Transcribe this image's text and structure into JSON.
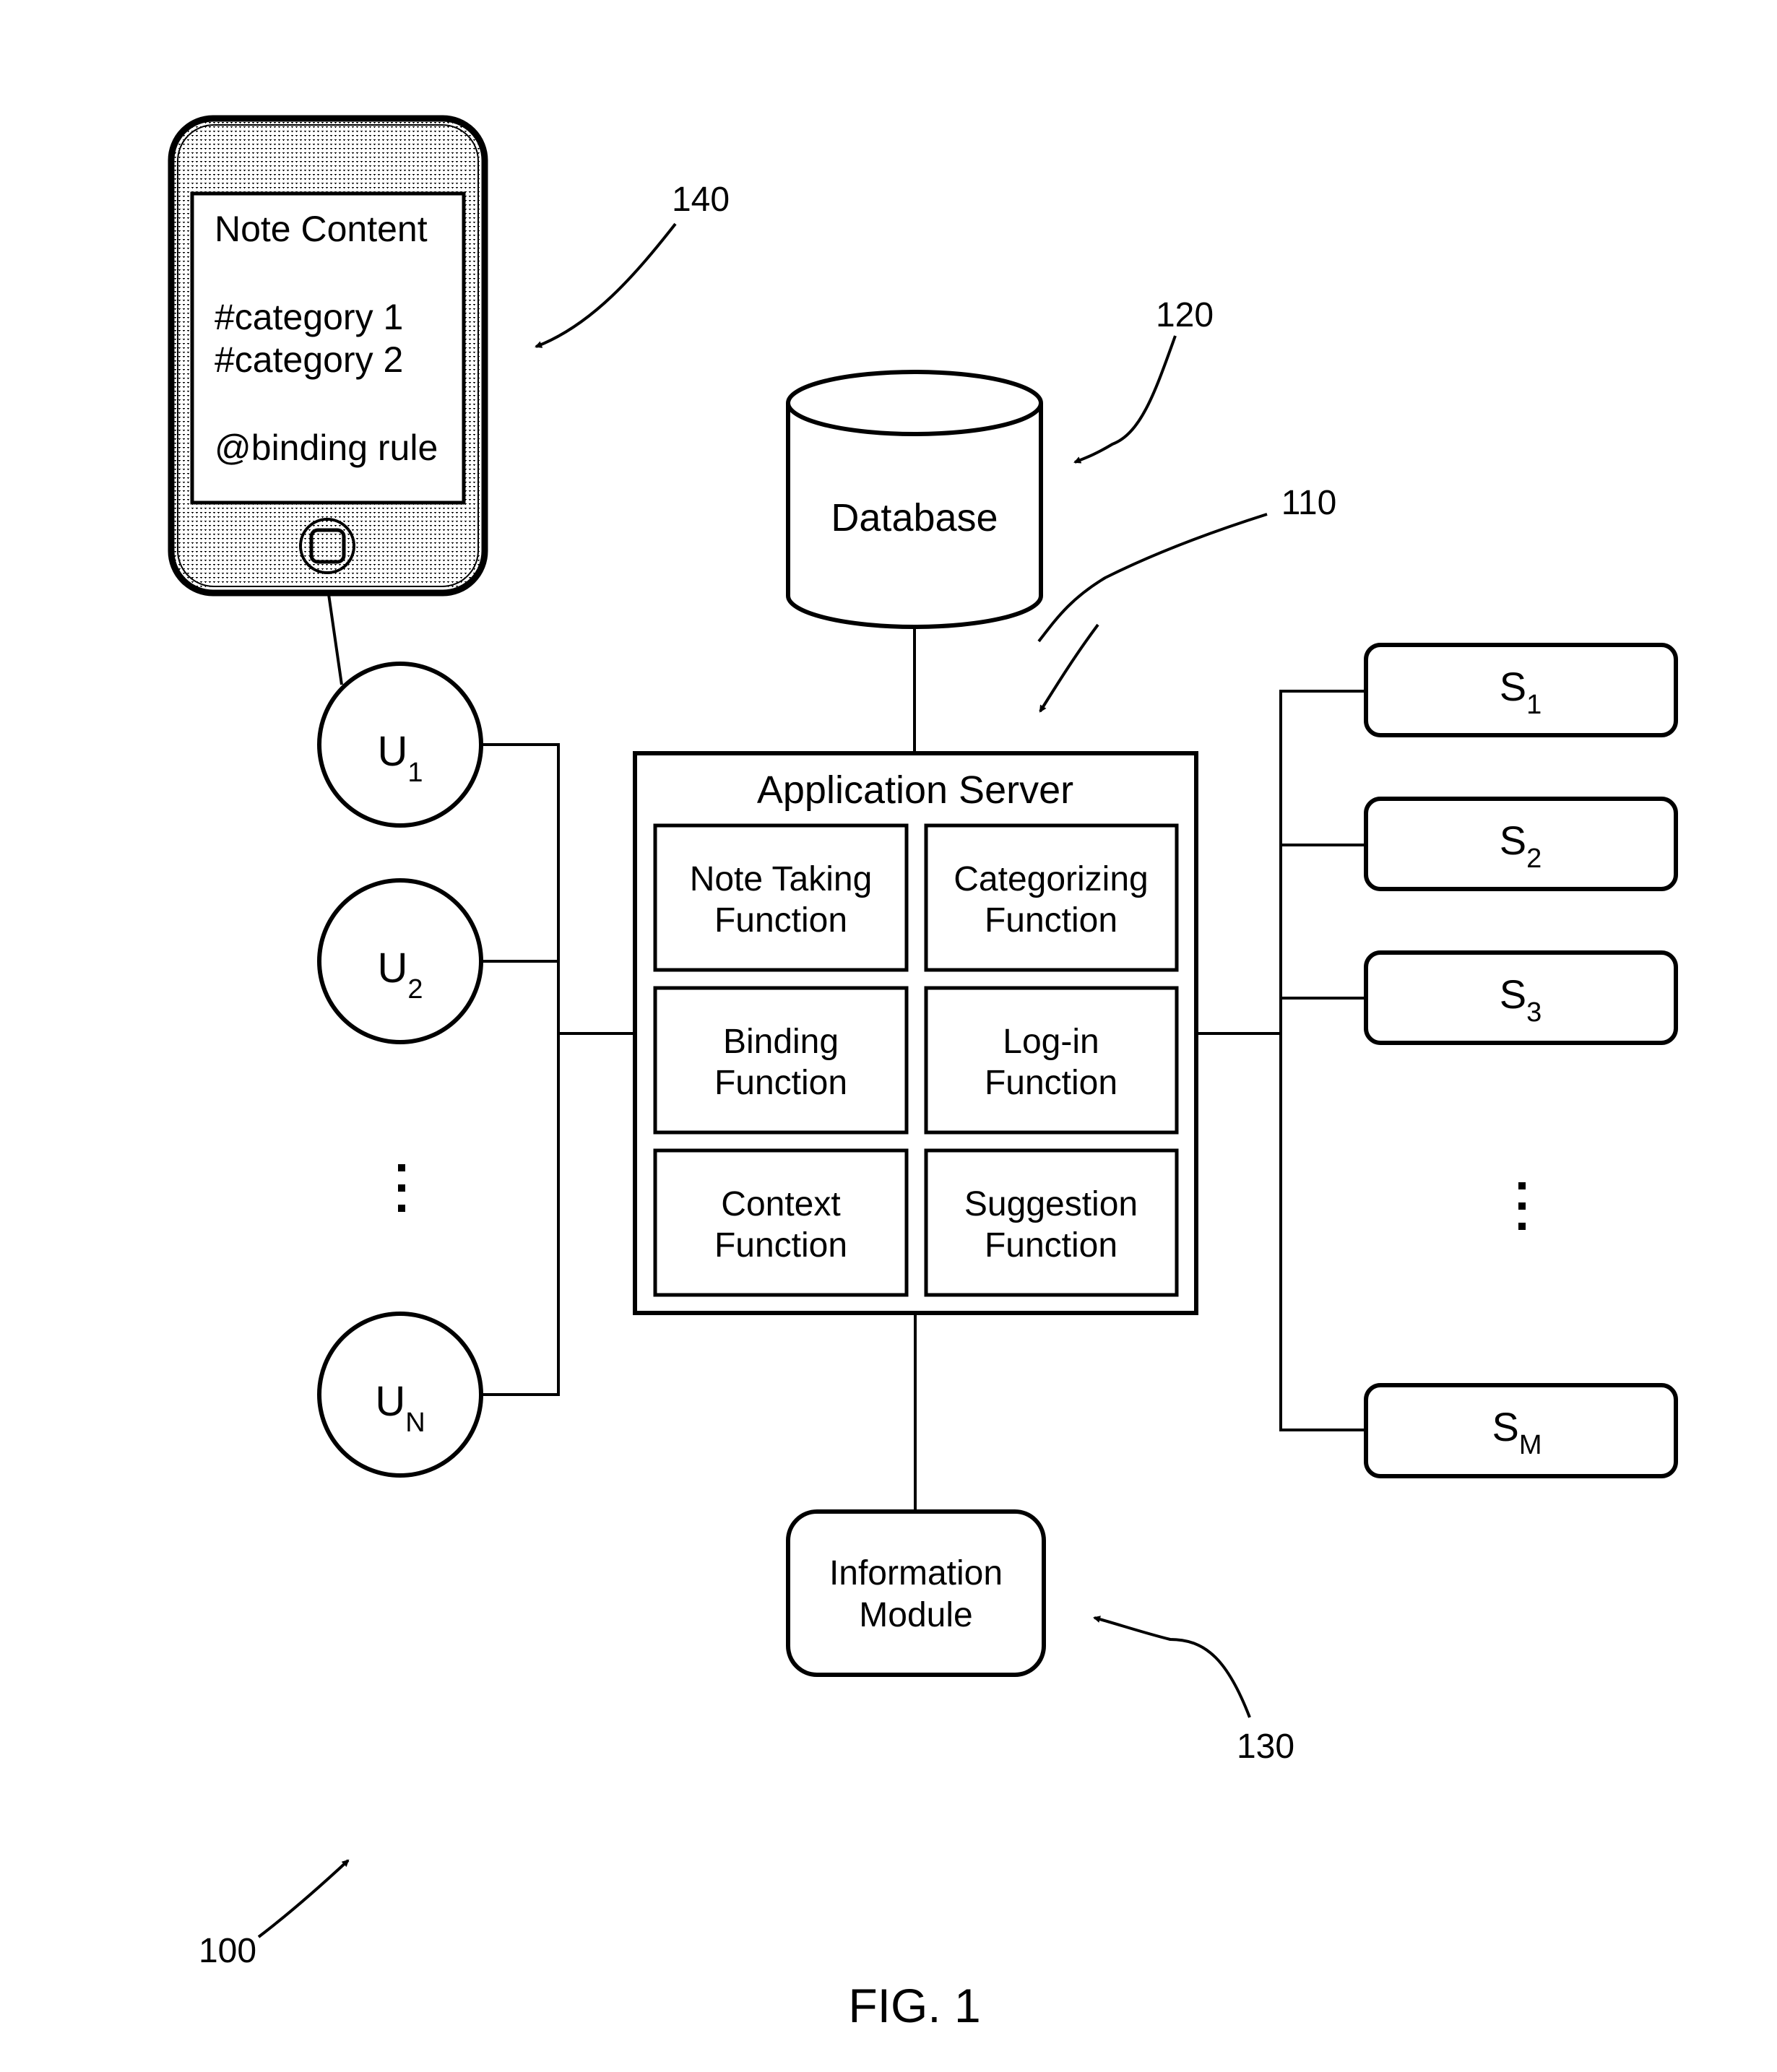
{
  "figure": {
    "caption": "FIG. 1",
    "reference_numerals": {
      "system": "100",
      "application_server": "110",
      "database": "120",
      "information_module": "130",
      "user_device": "140"
    }
  },
  "colors": {
    "stroke": "#000000",
    "background": "#ffffff",
    "device_fill_pattern": "dotted-gray"
  },
  "user_device": {
    "screen_lines": [
      "Note Content",
      "#category 1",
      "#category 2",
      "@binding rule"
    ],
    "icon": "smartphone-icon",
    "home_button_icon": "home-button-icon"
  },
  "users": [
    {
      "base": "U",
      "sub": "1"
    },
    {
      "base": "U",
      "sub": "2"
    },
    {
      "base": "U",
      "sub": "N"
    }
  ],
  "users_ellipsis": "⋮",
  "database": {
    "label": "Database"
  },
  "application_server": {
    "title": "Application Server",
    "functions": [
      {
        "line1": "Note Taking",
        "line2": "Function"
      },
      {
        "line1": "Categorizing",
        "line2": "Function"
      },
      {
        "line1": "Binding",
        "line2": "Function"
      },
      {
        "line1": "Log-in",
        "line2": "Function"
      },
      {
        "line1": "Context",
        "line2": "Function"
      },
      {
        "line1": "Suggestion",
        "line2": "Function"
      }
    ]
  },
  "services": [
    {
      "base": "S",
      "sub": "1"
    },
    {
      "base": "S",
      "sub": "2"
    },
    {
      "base": "S",
      "sub": "3"
    },
    {
      "base": "S",
      "sub": "M"
    }
  ],
  "services_ellipsis": "⋮",
  "information_module": {
    "line1": "Information",
    "line2": "Module"
  }
}
